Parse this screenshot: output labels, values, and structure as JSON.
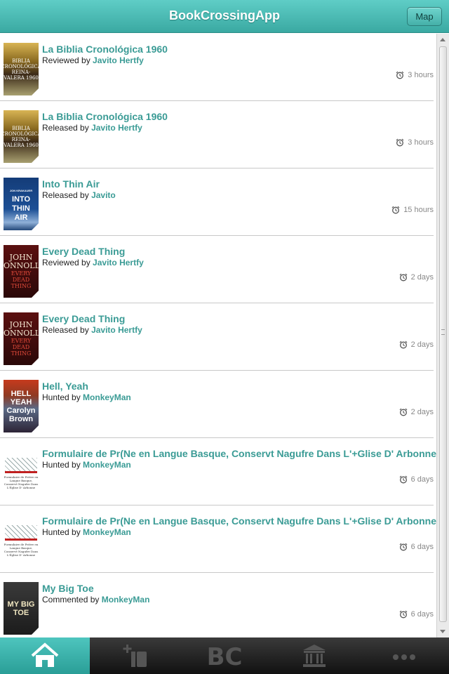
{
  "header": {
    "title": "BookCrossingApp",
    "map_label": "Map"
  },
  "feed": [
    {
      "title": "La Biblia Cronológica 1960",
      "action": "Reviewed by",
      "user": "Javito Hertfy",
      "time": "3 hours",
      "cover": "biblia"
    },
    {
      "title": "La Biblia Cronológica 1960",
      "action": "Released by",
      "user": "Javito Hertfy",
      "time": "3 hours",
      "cover": "biblia"
    },
    {
      "title": "Into Thin Air",
      "action": "Released by",
      "user": "Javito",
      "time": "15 hours",
      "cover": "thin"
    },
    {
      "title": "Every Dead Thing",
      "action": "Reviewed by",
      "user": "Javito Hertfy",
      "time": "2 days",
      "cover": "dead"
    },
    {
      "title": "Every Dead Thing",
      "action": "Released by",
      "user": "Javito Hertfy",
      "time": "2 days",
      "cover": "dead"
    },
    {
      "title": "Hell, Yeah",
      "action": "Hunted by",
      "user": "MonkeyMan",
      "time": "2 days",
      "cover": "hell"
    },
    {
      "title": "Formulaire de Pr(Ne en Langue Basque, Conservt Nagufre Dans L'+Glise D' Arbonne",
      "action": "Hunted by",
      "user": "MonkeyMan",
      "time": "6 days",
      "cover": "form"
    },
    {
      "title": "Formulaire de Pr(Ne en Langue Basque, Conservt Nagufre Dans L'+Glise D' Arbonne",
      "action": "Hunted by",
      "user": "MonkeyMan",
      "time": "6 days",
      "cover": "form"
    },
    {
      "title": "My Big Toe",
      "action": "Commented by",
      "user": "MonkeyMan",
      "time": "6 days",
      "cover": "toe"
    }
  ],
  "covers": {
    "biblia": [
      "BIBLIA",
      "CRONOLÓGICA",
      "REINA-VALERA 1960"
    ],
    "thin": [
      "JON KRAKAUER",
      "INTO",
      "THIN",
      "AIR"
    ],
    "dead": [
      "JOHN",
      "CONNOLLY",
      "EVERY DEAD",
      "THING"
    ],
    "hell": [
      "HELL",
      "YEAH",
      "Carolyn Brown"
    ],
    "form": [
      "Formulaire de Prière en Langue Basque, Conservé Nagufre Dans L'Église D' Arbonne"
    ],
    "toe": [
      "MY BIG TOE"
    ]
  },
  "tabs": [
    {
      "name": "home",
      "icon": "home-icon",
      "active": true
    },
    {
      "name": "release",
      "icon": "add-book-icon",
      "active": false
    },
    {
      "name": "bookcrossing",
      "icon": "bc-logo-icon",
      "label": "BC",
      "active": false
    },
    {
      "name": "library",
      "icon": "library-icon",
      "active": false
    },
    {
      "name": "more",
      "icon": "more-icon",
      "active": false
    }
  ],
  "colors": {
    "accent": "#3a9b95",
    "header": "#4bbab3",
    "tabbar": "#1e1e1e"
  }
}
